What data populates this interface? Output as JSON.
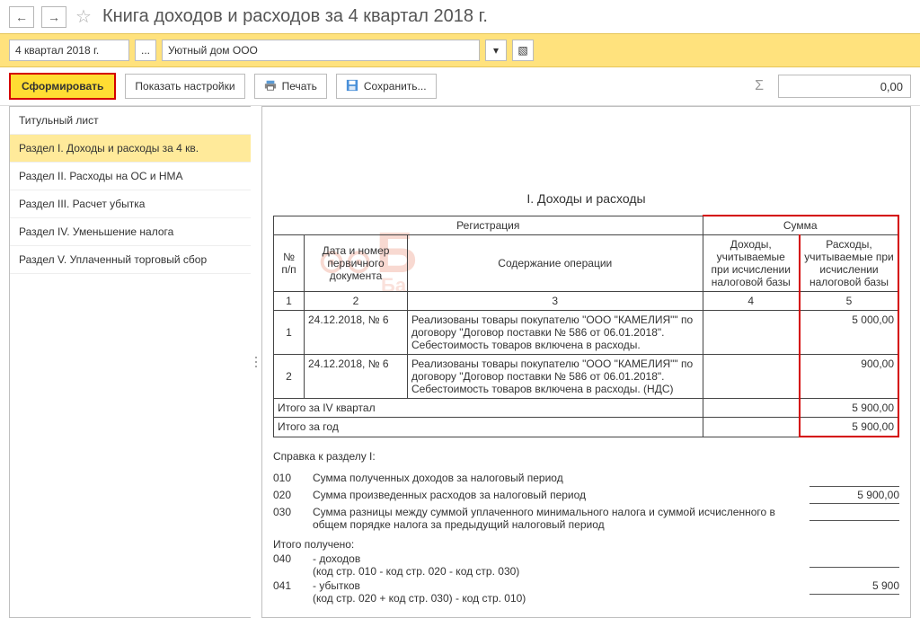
{
  "title": "Книга доходов и расходов за 4 квартал 2018 г.",
  "nav": {
    "back_glyph": "←",
    "fwd_glyph": "→",
    "star_glyph": "☆"
  },
  "filter": {
    "period": "4 квартал 2018 г.",
    "ellipsis": "...",
    "org": "Уютный дом ООО",
    "caret": "▾",
    "popout": "▧"
  },
  "toolbar": {
    "generate": "Сформировать",
    "settings": "Показать настройки",
    "print": "Печать",
    "save": "Сохранить...",
    "save_caret": "",
    "sigma": "Σ",
    "sum_value": "0,00"
  },
  "sidebar": {
    "items": [
      "Титульный лист",
      "Раздел I. Доходы и расходы за 4 кв.",
      "Раздел II. Расходы на ОС и НМА",
      "Раздел III. Расчет убытка",
      "Раздел IV. Уменьшение налога",
      "Раздел V. Уплаченный торговый сбор"
    ],
    "active_index": 1
  },
  "report": {
    "section_title": "I. Доходы и расходы",
    "headers": {
      "registration": "Регистрация",
      "sum": "Сумма",
      "num": "№\nп/п",
      "doc": "Дата и номер первичного документа",
      "operation": "Содержание операции",
      "income": "Доходы, учитываемые при исчислении налоговой базы",
      "expense": "Расходы, учитываемые при исчислении налоговой базы"
    },
    "index_row": {
      "c1": "1",
      "c2": "2",
      "c3": "3",
      "c4": "4",
      "c5": "5"
    },
    "rows": [
      {
        "num": "1",
        "doc": "24.12.2018, № 6",
        "operation": "Реализованы товары покупателю \"ООО \"КАМЕЛИЯ\"\" по договору \"Договор поставки № 586 от 06.01.2018\". Себестоимость товаров включена в расходы.",
        "income": "",
        "expense": "5 000,00"
      },
      {
        "num": "2",
        "doc": "24.12.2018, № 6",
        "operation": "Реализованы товары покупателю \"ООО \"КАМЕЛИЯ\"\" по договору \"Договор поставки № 586 от 06.01.2018\". Себестоимость товаров включена в расходы. (НДС)",
        "income": "",
        "expense": "900,00"
      }
    ],
    "totals": {
      "q4_label": "Итого за IV квартал",
      "q4_expense": "5 900,00",
      "year_label": "Итого за год",
      "year_expense": "5 900,00"
    },
    "reference": {
      "heading": "Справка к разделу I:",
      "r010": {
        "code": "010",
        "text": "Сумма полученных доходов за налоговый период",
        "val": ""
      },
      "r020": {
        "code": "020",
        "text": "Сумма произведенных  расходов за налоговый период",
        "val": "5 900,00"
      },
      "r030": {
        "code": "030",
        "text": "Сумма разницы между  суммой уплаченного минимального налога и суммой исчисленного в общем порядке налога за предыдущий налоговый период",
        "val": ""
      },
      "subtotal_label": "Итого получено:",
      "r040": {
        "code": "040",
        "text": "- доходов",
        "sub": "(код стр. 010 - код  стр. 020 - код стр. 030)",
        "val": ""
      },
      "r041": {
        "code": "041",
        "text": "- убытков",
        "sub": "(код стр. 020 + код  стр. 030) - код стр. 010)",
        "val": "5 900"
      }
    }
  }
}
